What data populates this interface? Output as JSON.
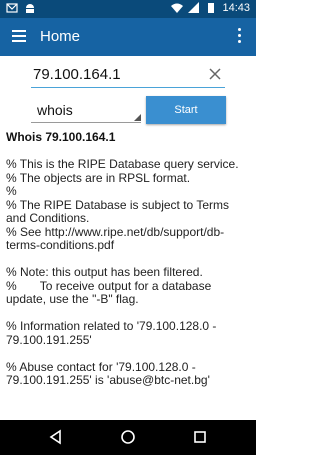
{
  "status_bar": {
    "time": "14:43",
    "icons": [
      "mail-icon",
      "android-icon",
      "wifi-icon",
      "signal-icon",
      "battery-icon"
    ]
  },
  "app_bar": {
    "title": "Home",
    "colors": {
      "primary": "#1663a3",
      "status": "#0a4a7a"
    }
  },
  "query": {
    "value": "79.100.164.1"
  },
  "type_select": {
    "value": "whois"
  },
  "start_button": {
    "label": "Start",
    "color": "#3a8fd0"
  },
  "result": {
    "title": "Whois 79.100.164.1",
    "text": "% This is the RIPE Database query service.\n% The objects are in RPSL format.\n%\n% The RIPE Database is subject to Terms and Conditions.\n% See http://www.ripe.net/db/support/db-terms-conditions.pdf\n\n% Note: this output has been filtered.\n%       To receive output for a database update, use the \"-B\" flag.\n\n% Information related to '79.100.128.0 - 79.100.191.255'\n\n% Abuse contact for '79.100.128.0 - 79.100.191.255' is 'abuse@btc-net.bg'"
  },
  "nav_bar": {
    "buttons": [
      "back-icon",
      "home-icon",
      "recents-icon"
    ]
  }
}
